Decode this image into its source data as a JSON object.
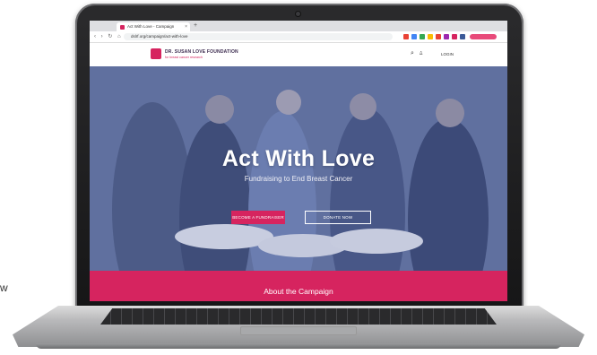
{
  "page": {
    "stray_text": "w"
  },
  "browser": {
    "tab_title": "Act With Love - Campaign",
    "tab_close": "×",
    "new_tab": "+",
    "address": "dslrf.org/campaign/act-with-love",
    "nav_buttons": "‹ › ↻ ⌂"
  },
  "site": {
    "logo_name": "DR. SUSAN LOVE FOUNDATION",
    "logo_tagline": "for breast cancer research",
    "login_label": "LOGIN",
    "search_glyph": "⌕",
    "user_glyph": "♙"
  },
  "hero": {
    "title": "Act With Love",
    "subtitle": "Fundraising to End Breast Cancer",
    "primary_button": "BECOME A FUNDRAISER",
    "secondary_button": "DONATE NOW"
  },
  "section": {
    "title": "About the Campaign"
  },
  "colors": {
    "brand_pink": "#d6245f",
    "hero_overlay": "#5a6b9b",
    "laptop_bezel": "#1f1f21"
  }
}
